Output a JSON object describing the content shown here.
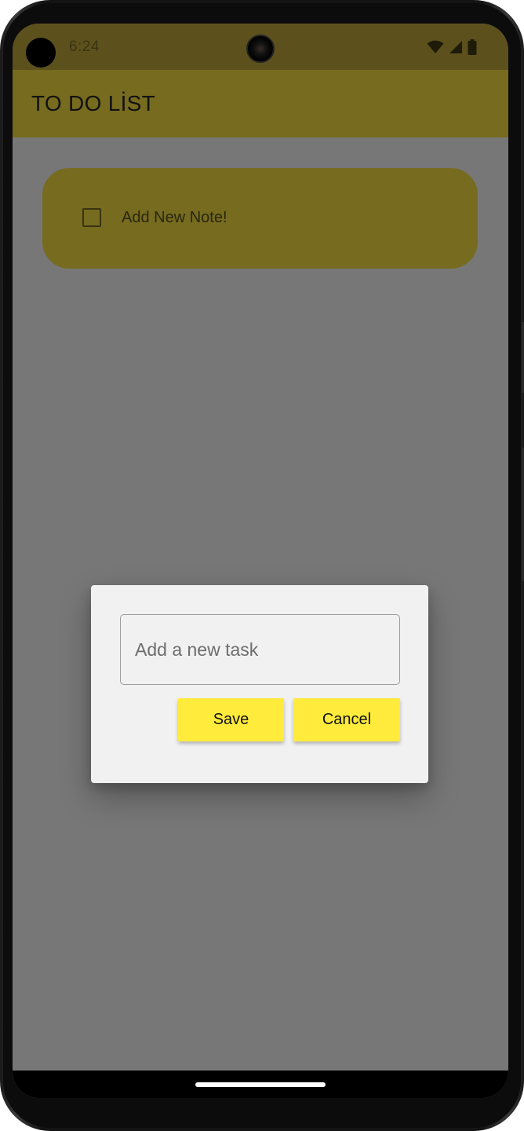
{
  "status_bar": {
    "time": "6:24",
    "icons": [
      "wifi-icon",
      "cell-signal-icon",
      "battery-icon"
    ]
  },
  "app_bar": {
    "title": "TO DO LİST"
  },
  "tasks": [
    {
      "label": "Add New Note!",
      "checked": false
    }
  ],
  "dialog": {
    "input_placeholder": "Add a new task",
    "input_value": "",
    "save_label": "Save",
    "cancel_label": "Cancel"
  },
  "fab": {
    "icon": "plus-icon"
  },
  "colors": {
    "status_bar": "#5c511d",
    "app_bar": "#766b1f",
    "scrim_background": "#777777",
    "dialog_background": "#f1f1f1",
    "button_background": "#ffeb3b",
    "fab": "#766b1f"
  }
}
